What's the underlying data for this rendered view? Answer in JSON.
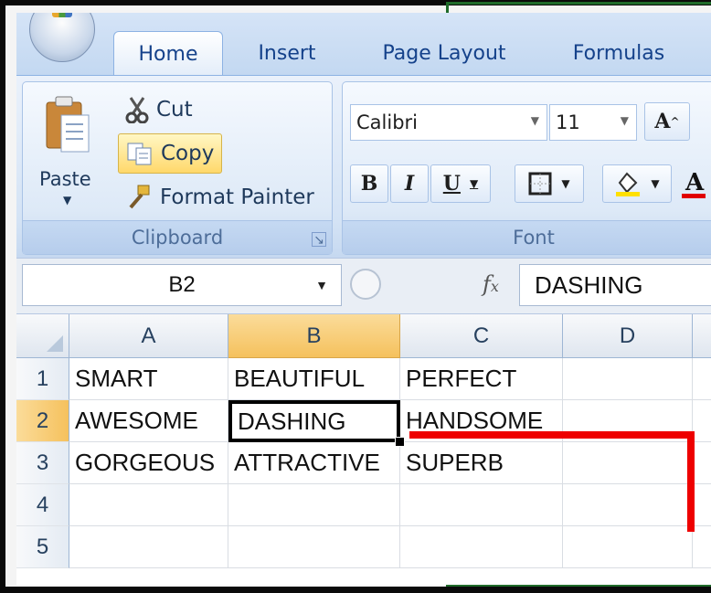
{
  "tabs": [
    {
      "label": "Home",
      "active": true
    },
    {
      "label": "Insert",
      "active": false
    },
    {
      "label": "Page Layout",
      "active": false
    },
    {
      "label": "Formulas",
      "active": false
    }
  ],
  "clipboard": {
    "title": "Clipboard",
    "paste": "Paste",
    "cut": "Cut",
    "copy": "Copy",
    "format_painter": "Format Painter"
  },
  "font": {
    "title": "Font",
    "name": "Calibri",
    "size": "11",
    "bold": "B",
    "italic": "I",
    "underline": "U",
    "grow": "A"
  },
  "formula_bar": {
    "name_box": "B2",
    "fx": "fx",
    "value": "DASHING"
  },
  "grid": {
    "columns": [
      "A",
      "B",
      "C",
      "D"
    ],
    "rows": [
      {
        "num": "1",
        "cells": [
          "SMART",
          "BEAUTIFUL",
          "PERFECT",
          ""
        ]
      },
      {
        "num": "2",
        "cells": [
          "AWESOME",
          "DASHING",
          "HANDSOME",
          ""
        ]
      },
      {
        "num": "3",
        "cells": [
          "GORGEOUS",
          "ATTRACTIVE",
          "SUPERB",
          ""
        ]
      },
      {
        "num": "4",
        "cells": [
          "",
          "",
          "",
          ""
        ]
      },
      {
        "num": "5",
        "cells": [
          "",
          "",
          "",
          ""
        ]
      }
    ],
    "active_cell": "B2",
    "selected_column": "B",
    "selected_row": "2"
  },
  "colors": {
    "accent_tab_text": "#15428b",
    "selected_header": "#f5c15d",
    "annotation_line": "#ee0000"
  }
}
